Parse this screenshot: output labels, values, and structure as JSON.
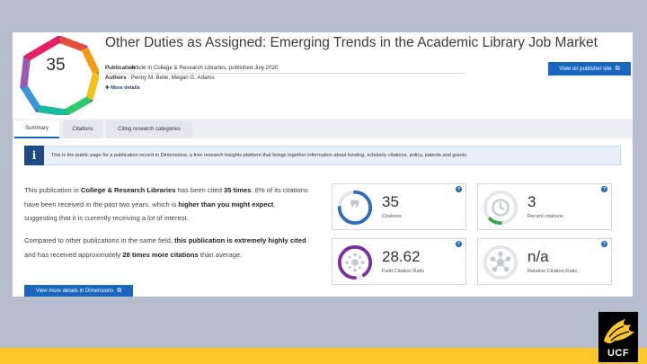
{
  "publication": {
    "title": "Other Duties as Assigned: Emerging Trends in the Academic Library Job Market",
    "publication_label": "Publication",
    "publication_value": "Article in College & Research Libraries, published July 2020",
    "authors_label": "Authors",
    "authors_value": "Penny M. Beile, Megan G. Adams",
    "more_details": "More details",
    "view_button": "View on publisher site"
  },
  "badge": {
    "score": "35"
  },
  "tabs": [
    {
      "label": "Summary"
    },
    {
      "label": "Citations"
    },
    {
      "label": "Citing research categories"
    }
  ],
  "info": {
    "text": "This is the public page for a publication record in Dimensions, a free research insights platform that brings together information about funding, scholarly citations, policy, patents and grants."
  },
  "summary": {
    "p1": {
      "t1": "This publication in ",
      "b1": "College & Research Libraries",
      "t2": " has been cited ",
      "b2": "35 times",
      "t3": ". 8% of its citations have been received in the past two years, which is ",
      "b3": "higher than you might expect",
      "t4": ", suggesting that it is currently receiving a lot of interest."
    },
    "p2": {
      "t1": "Compared to other publications in the same field, ",
      "b1": "this publication is extremely highly cited",
      "t2": " and has received approximately ",
      "b2": "28 times more citations",
      "t3": " than average."
    },
    "button": "View more details in Dimensions"
  },
  "metrics": [
    {
      "value": "35",
      "label": "Citations",
      "icon": "quote-icon",
      "color": "#2f6dbb",
      "fill": 0.75
    },
    {
      "value": "3",
      "label": "Recent citations",
      "icon": "clock-icon",
      "color": "#3aa84a",
      "fill": 0.12
    },
    {
      "value": "28.62",
      "label": "Field Citation Ratio",
      "icon": "field-ratio-icon",
      "color": "#7a2fa3",
      "fill": 0.9
    },
    {
      "value": "n/a",
      "label": "Relative Citation Ratio",
      "icon": "network-icon",
      "color": "#b9bec6",
      "fill": 0
    }
  ],
  "logo": {
    "text": "UCF"
  }
}
